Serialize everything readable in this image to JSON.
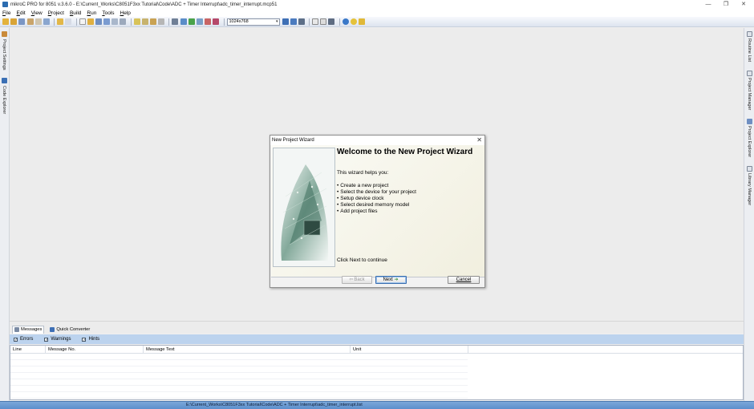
{
  "window": {
    "title": "mikroC PRO for 8051 v.3.6.0 - E:\\Current_Works\\C8051F3xx Tutorial\\Code\\ADC + Timer Interrupt\\adc_timer_interrupt.mcp51",
    "minimize": "—",
    "restore": "❐",
    "close": "✕"
  },
  "menu": {
    "items": [
      {
        "key": "F",
        "rest": "ile"
      },
      {
        "key": "E",
        "rest": "dit"
      },
      {
        "key": "V",
        "rest": "iew"
      },
      {
        "key": "P",
        "rest": "roject"
      },
      {
        "key": "B",
        "rest": "uild"
      },
      {
        "key": "R",
        "rest": "un"
      },
      {
        "key": "T",
        "rest": "ools"
      },
      {
        "key": "H",
        "rest": "elp"
      }
    ]
  },
  "toolbar": {
    "resolution": "1024x768",
    "dropdown_arrow": "▾"
  },
  "left_panels": {
    "project_settings": "Project Settings",
    "code_explorer": "Code Explorer"
  },
  "right_panels": {
    "routine_list": "Routine List",
    "project_manager": "Project Manager",
    "project_explorer": "Project Explorer",
    "library_manager": "Library Manager"
  },
  "dialog": {
    "title": "New Project Wizard",
    "close": "✕",
    "heading": "Welcome to the New Project Wizard",
    "intro": "This wizard helps you:",
    "steps": [
      "Create a new project",
      "Select the device for your project",
      "Setup device clock",
      "Select desired memory model",
      "Add project files"
    ],
    "footer_note": "Click Next to continue",
    "back_label": "Back",
    "back_glyph": "⇦",
    "next_label": "Next",
    "next_glyph": "➔",
    "cancel_label": "Cancel"
  },
  "splitter": {
    "grip": "........"
  },
  "messages_panel": {
    "tabs": [
      "Messages",
      "Quick Converter"
    ],
    "filters": [
      {
        "label": "Errors",
        "checked": "✓"
      },
      {
        "label": "Warnings",
        "checked": "✓"
      },
      {
        "label": "Hints",
        "checked": "✓"
      }
    ],
    "columns": [
      "Line",
      "Message No.",
      "Message Text",
      "Unit"
    ]
  },
  "status": {
    "path": "E:\\Current_Works\\C8051F3xx Tutorial\\Code\\ADC + Timer Interrupt\\adc_timer_interrupt.list"
  },
  "colors": {
    "accent": "#2b6cb0",
    "filterbar": "#bcd3ee",
    "statusbar": "#6b9bd2"
  }
}
